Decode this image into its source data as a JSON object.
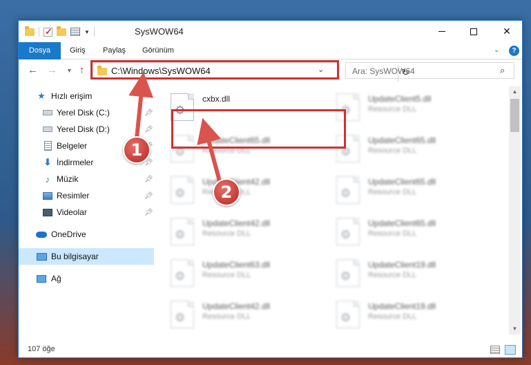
{
  "window": {
    "title": "SysWOW64",
    "controls": {
      "minimize": "—",
      "maximize": "",
      "close": "✕"
    }
  },
  "ribbon": {
    "tabs": [
      "Dosya",
      "Giriş",
      "Paylaş",
      "Görünüm"
    ],
    "help": "?"
  },
  "navigation": {
    "address": "C:\\Windows\\SysWOW64",
    "search_placeholder": "Ara: SysWOW64"
  },
  "sidebar": {
    "items": [
      {
        "label": "Hızlı erişim",
        "icon": "star-icon"
      },
      {
        "label": "Yerel Disk (C:)",
        "icon": "drive-icon",
        "pinned": true
      },
      {
        "label": "Yerel Disk (D:)",
        "icon": "drive-icon",
        "pinned": true
      },
      {
        "label": "Belgeler",
        "icon": "documents-icon",
        "pinned": true
      },
      {
        "label": "İndirmeler",
        "icon": "download-icon",
        "pinned": true
      },
      {
        "label": "Müzik",
        "icon": "music-icon",
        "pinned": true
      },
      {
        "label": "Resimler",
        "icon": "pictures-icon",
        "pinned": true
      },
      {
        "label": "Videolar",
        "icon": "videos-icon",
        "pinned": true
      },
      {
        "label": "OneDrive",
        "icon": "cloud-icon"
      },
      {
        "label": "Bu bilgisayar",
        "icon": "computer-icon",
        "selected": true
      },
      {
        "label": "Ağ",
        "icon": "network-icon"
      }
    ]
  },
  "files": [
    {
      "name": "cxbx.dll",
      "type": ""
    },
    {
      "name": "UpdateClient5.dll",
      "type": "Resource DLL"
    },
    {
      "name": "UpdateClient65.dll",
      "type": "Resource DLL"
    },
    {
      "name": "UpdateClient65.dll",
      "type": "Resource DLL"
    },
    {
      "name": "UpdateClient42.dll",
      "type": "Resource DLL"
    },
    {
      "name": "UpdateClient65.dll",
      "type": "Resource DLL"
    },
    {
      "name": "UpdateClient42.dll",
      "type": "Resource DLL"
    },
    {
      "name": "UpdateClient65.dll",
      "type": "Resource DLL"
    },
    {
      "name": "UpdateClient63.dll",
      "type": "Resource DLL"
    },
    {
      "name": "UpdateClient19.dll",
      "type": "Resource DLL"
    },
    {
      "name": "UpdateClient42.dll",
      "type": "Resource DLL"
    },
    {
      "name": "UpdateClient19.dll",
      "type": "Resource DLL"
    }
  ],
  "status": {
    "item_count": "107 öğe"
  },
  "callouts": {
    "one": "1",
    "two": "2"
  },
  "colors": {
    "accent": "#1979ca",
    "highlight": "#d32f2f",
    "selection": "#cce8ff"
  }
}
